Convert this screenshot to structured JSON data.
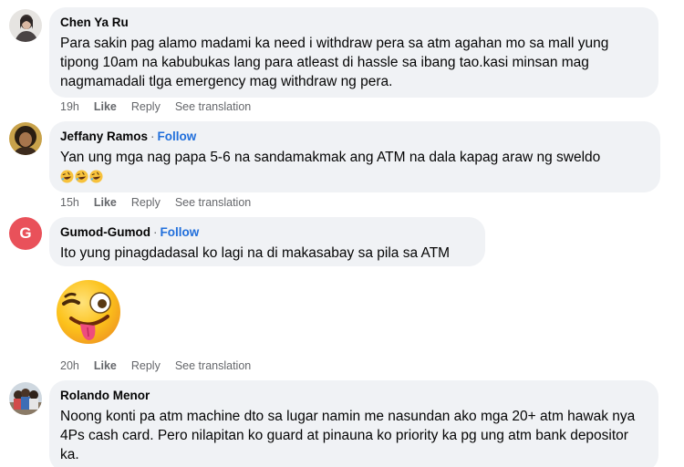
{
  "comments": [
    {
      "author": "Chen Ya Ru",
      "follow": "",
      "text": "Para sakin pag alamo madami ka need i withdraw pera sa atm agahan mo sa mall yung tipong 10am na kabubukas lang para atleast di hassle sa ibang tao.kasi minsan mag nagmamadali tlga emergency mag withdraw ng pera.",
      "time": "19h",
      "like": "Like",
      "reply": "Reply",
      "translation": "See translation"
    },
    {
      "author": "Jeffany Ramos",
      "separator": "·",
      "follow": "Follow",
      "text": "Yan ung mga nag papa 5-6 na sandamakmak ang ATM na dala kapag araw ng sweldo",
      "emojis": [
        "rolling-laughing",
        "rolling-laughing",
        "rolling-laughing"
      ],
      "time": "15h",
      "like": "Like",
      "reply": "Reply",
      "translation": "See translation"
    },
    {
      "author": "Gumod-Gumod",
      "separator": "·",
      "follow": "Follow",
      "avatar_letter": "G",
      "text": "Ito yung pinagdadasal ko lagi na di makasabay sa pila sa ATM",
      "sticker": "winking-tongue-face",
      "time": "20h",
      "like": "Like",
      "reply": "Reply",
      "translation": "See translation"
    },
    {
      "author": "Rolando Menor",
      "follow": "",
      "text": "Noong konti pa atm machine dto sa lugar namin me nasundan ako mga 20+ atm hawak nya 4Ps cash card. Pero nilapitan ko guard at pinauna ko priority ka pg ung atm bank depositor ka."
    }
  ],
  "colors": {
    "bubble": "#f0f2f5",
    "follow": "#216fdb",
    "meta": "#65676b",
    "avatar_g": "#e9515a"
  }
}
